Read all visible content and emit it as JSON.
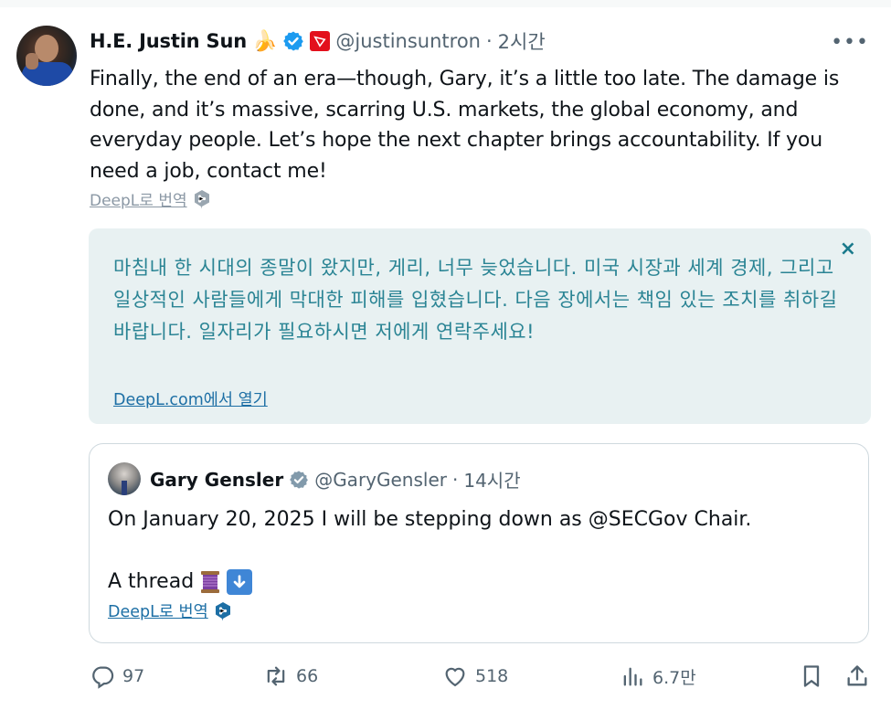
{
  "author": {
    "name": "H.E. Justin Sun",
    "emoji": "🍌",
    "handle": "@justinsuntron",
    "separator": "·",
    "time": "2시간"
  },
  "more_label": "•••",
  "tweet": {
    "text": "Finally, the end of an era—though, Gary, it’s a little too late. The damage is done, and it’s massive, scarring U.S. markets, the global economy, and everyday people. Let’s hope the next chapter brings accountability. If you need a job, contact me!"
  },
  "deepl": {
    "translate_label": "DeepL로 번역"
  },
  "translation": {
    "text": "마침내 한 시대의 종말이 왔지만, 게리, 너무 늦었습니다. 미국 시장과 세계 경제, 그리고 일상적인 사람들에게 막대한 피해를 입혔습니다. 다음 장에서는 책임 있는 조치를 취하길 바랍니다. 일자리가 필요하시면 저에게 연락주세요!",
    "open_label": "DeepL.com에서 열기",
    "close_label": "×"
  },
  "quote": {
    "name": "Gary Gensler",
    "handle": "@GaryGensler",
    "separator": "·",
    "time": "14시간",
    "line1": "On January 20, 2025 I will be stepping down as @SECGov Chair.",
    "line2": "A thread",
    "translate_label": "DeepL로 번역"
  },
  "actions": {
    "replies": "97",
    "reposts": "66",
    "likes": "518",
    "views": "6.7만"
  },
  "colors": {
    "verified_blue": "#1d9bf0",
    "tron_red": "#e3101c",
    "translation_bg": "#e8f1f2",
    "translation_text": "#2a8494",
    "link": "#1d6fa5"
  }
}
